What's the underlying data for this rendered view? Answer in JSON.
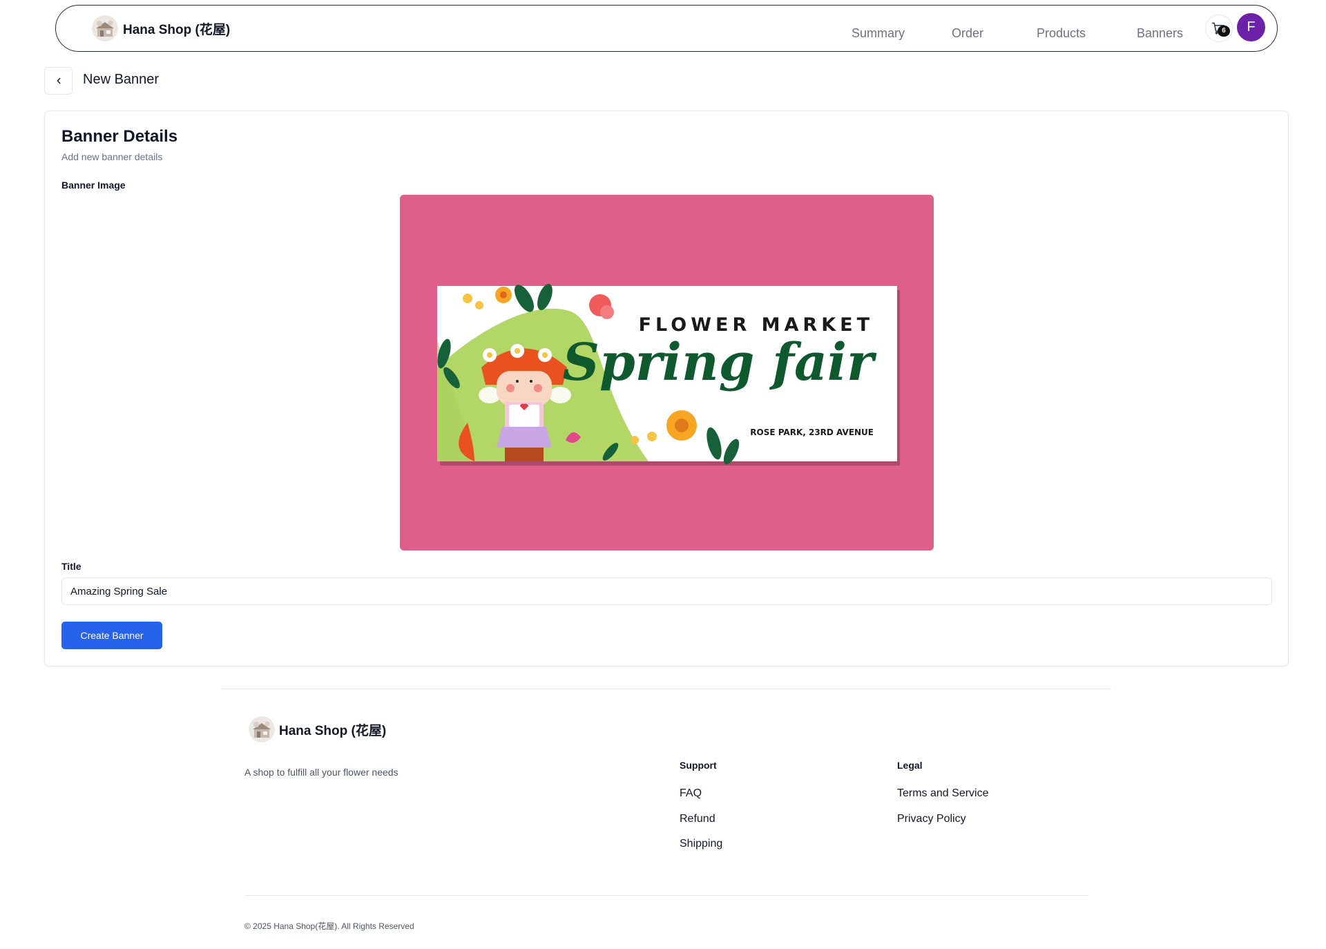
{
  "navbar": {
    "brand_name": "Hana Shop (花屋)",
    "links": [
      "Summary",
      "Order",
      "Products",
      "Banners"
    ],
    "cart_count": "6",
    "avatar_initial": "F"
  },
  "page": {
    "title": "New Banner"
  },
  "card": {
    "title": "Banner Details",
    "subtitle": "Add new banner details",
    "image_label": "Banner Image",
    "title_label": "Title",
    "title_value": "Amazing Spring Sale",
    "submit_label": "Create Banner"
  },
  "banner_image": {
    "headline": "FLOWER MARKET",
    "script_text": "Spring fair",
    "location": "ROSE PARK, 23RD AVENUE"
  },
  "footer": {
    "brand_name": "Hana Shop (花屋)",
    "tagline": "A shop to fulfill all your flower needs",
    "support_heading": "Support",
    "support_links": [
      "FAQ",
      "Refund",
      "Shipping"
    ],
    "legal_heading": "Legal",
    "legal_links": [
      "Terms and Service",
      "Privacy Policy"
    ],
    "copyright": "© 2025 Hana Shop(花屋). All Rights Reserved"
  },
  "colors": {
    "primary_button": "#2563eb",
    "avatar_bg": "#6b21a8",
    "banner_bg": "#de608a",
    "banner_green": "#0e5a2e"
  },
  "icons": [
    "shop-logo",
    "cart-icon",
    "chevron-left-icon"
  ]
}
